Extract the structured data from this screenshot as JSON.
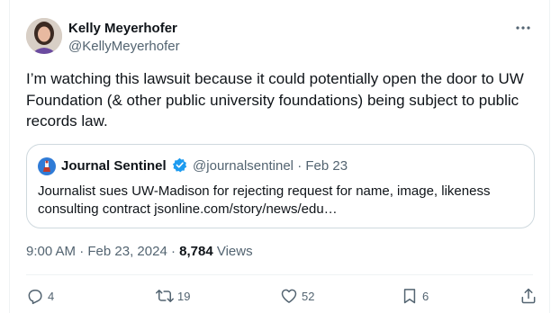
{
  "author": {
    "display_name": "Kelly Meyerhofer",
    "handle": "@KellyMeyerhofer"
  },
  "tweet": {
    "text": "I’m watching this lawsuit  because it could potentially open the door to UW Foundation (& other public university foundations) being subject to public records law."
  },
  "quote": {
    "display_name": "Journal Sentinel",
    "handle": "@journalsentinel",
    "separator": "·",
    "date": "Feb 23",
    "text": "Journalist sues UW-Madison for rejecting request for name, image, likeness consulting contract jsonline.com/story/news/edu…"
  },
  "meta": {
    "time": "9:00 AM",
    "dot1": "·",
    "date": "Feb 23, 2024",
    "dot2": "·",
    "views_count": "8,784",
    "views_label": "Views"
  },
  "actions": {
    "replies": "4",
    "reposts": "19",
    "likes": "52",
    "bookmarks": "6"
  },
  "icons": [
    "more-icon",
    "verified-icon",
    "reply-icon",
    "repost-icon",
    "like-icon",
    "bookmark-icon",
    "share-icon"
  ],
  "colors": {
    "text_primary": "#0f1419",
    "text_secondary": "#536471",
    "border": "#cfd9de",
    "verified": "#1d9bf0"
  }
}
